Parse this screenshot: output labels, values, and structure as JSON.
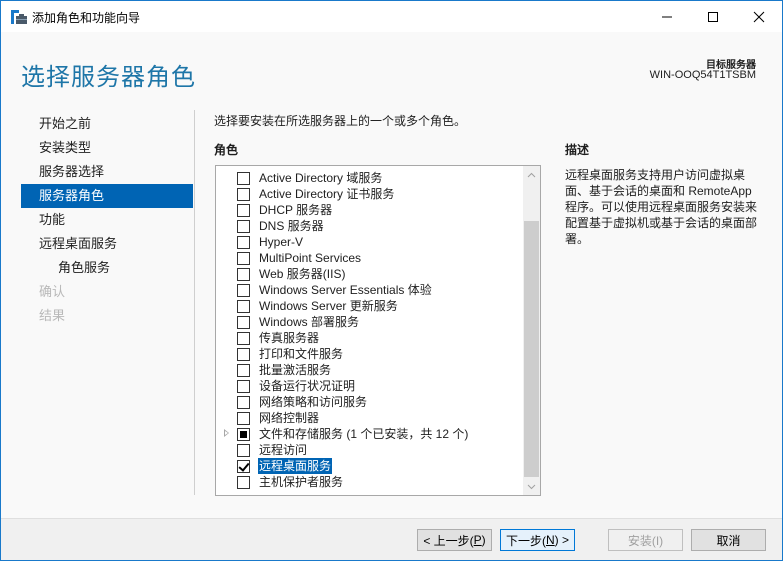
{
  "window": {
    "title": "添加角色和功能向导",
    "controls": {
      "minimize": "—",
      "maximize": "☐",
      "close": "✕"
    }
  },
  "header": {
    "page_title": "选择服务器角色",
    "target_server_label": "目标服务器",
    "target_server_name": "WIN-OOQ54T1TSBM"
  },
  "sidebar": {
    "items": [
      {
        "label": "开始之前",
        "state": "normal"
      },
      {
        "label": "安装类型",
        "state": "normal"
      },
      {
        "label": "服务器选择",
        "state": "normal"
      },
      {
        "label": "服务器角色",
        "state": "active"
      },
      {
        "label": "功能",
        "state": "normal"
      },
      {
        "label": "远程桌面服务",
        "state": "normal"
      },
      {
        "label": "角色服务",
        "state": "sub"
      },
      {
        "label": "确认",
        "state": "disabled"
      },
      {
        "label": "结果",
        "state": "disabled"
      }
    ]
  },
  "main": {
    "instruction": "选择要安装在所选服务器上的一个或多个角色。",
    "roles_header": "角色",
    "roles": [
      {
        "label": "Active Directory 域服务",
        "checked": false
      },
      {
        "label": "Active Directory 证书服务",
        "checked": false
      },
      {
        "label": "DHCP 服务器",
        "checked": false
      },
      {
        "label": "DNS 服务器",
        "checked": false
      },
      {
        "label": "Hyper-V",
        "checked": false
      },
      {
        "label": "MultiPoint Services",
        "checked": false
      },
      {
        "label": "Web 服务器(IIS)",
        "checked": false
      },
      {
        "label": "Windows Server Essentials 体验",
        "checked": false
      },
      {
        "label": "Windows Server 更新服务",
        "checked": false
      },
      {
        "label": "Windows 部署服务",
        "checked": false
      },
      {
        "label": "传真服务器",
        "checked": false
      },
      {
        "label": "打印和文件服务",
        "checked": false
      },
      {
        "label": "批量激活服务",
        "checked": false
      },
      {
        "label": "设备运行状况证明",
        "checked": false
      },
      {
        "label": "网络策略和访问服务",
        "checked": false
      },
      {
        "label": "网络控制器",
        "checked": false
      },
      {
        "label": "文件和存储服务 (1 个已安装，共 12 个)",
        "checked": "partial",
        "expandable": true
      },
      {
        "label": "远程访问",
        "checked": false
      },
      {
        "label": "远程桌面服务",
        "checked": true,
        "selected": true
      },
      {
        "label": "主机保护者服务",
        "checked": false
      }
    ]
  },
  "description": {
    "header": "描述",
    "text": "远程桌面服务支持用户访问虚拟桌面、基于会话的桌面和 RemoteApp 程序。可以使用远程桌面服务安装来配置基于虚拟机或基于会话的桌面部署。"
  },
  "footer": {
    "prev_label": "< 上一步(",
    "prev_key": "P",
    "next_label": "下一步(",
    "next_key": "N",
    "next_suffix": ") >",
    "prev_suffix": ")",
    "install_label": "安装(I)",
    "cancel_label": "取消"
  },
  "colors": {
    "accent": "#0064b4",
    "title": "#1e76a8",
    "window_border": "#1979ca"
  }
}
